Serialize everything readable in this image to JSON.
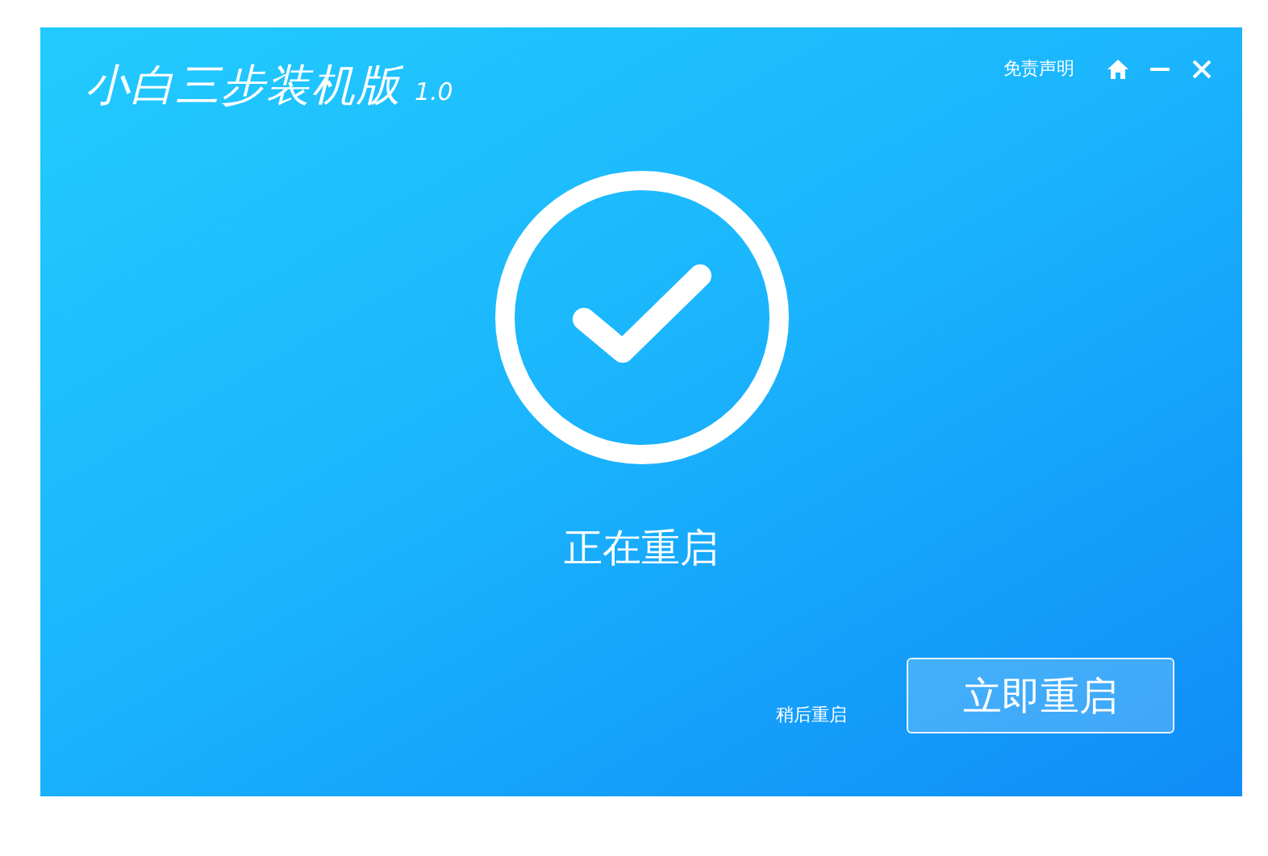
{
  "window": {
    "title": "小白三步装机版",
    "version": "1.0"
  },
  "header": {
    "disclaimer": "免责声明"
  },
  "status": {
    "text": "正在重启"
  },
  "actions": {
    "later": "稍后重启",
    "restart": "立即重启"
  }
}
